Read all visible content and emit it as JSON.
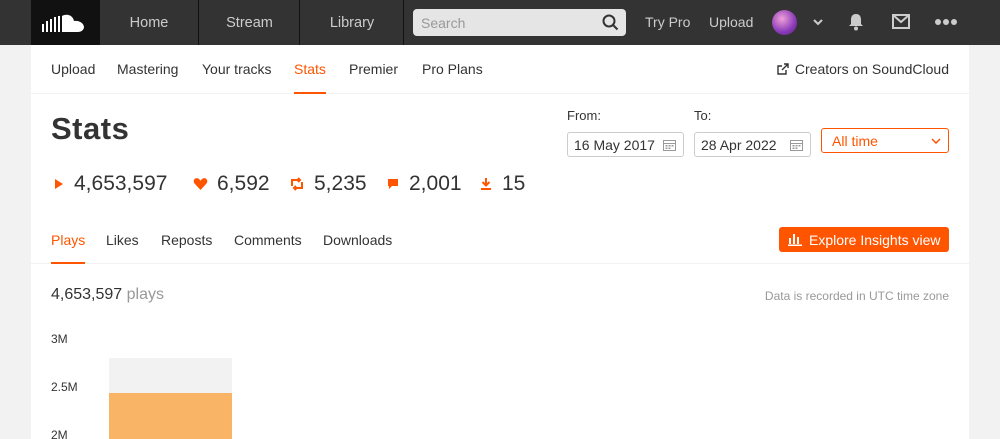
{
  "header": {
    "nav": [
      "Home",
      "Stream",
      "Library"
    ],
    "search_placeholder": "Search",
    "try_pro": "Try Pro",
    "upload": "Upload"
  },
  "subnav": {
    "items": [
      "Upload",
      "Mastering",
      "Your tracks",
      "Stats",
      "Premier",
      "Pro Plans"
    ],
    "active": "Stats",
    "creators": "Creators on SoundCloud"
  },
  "page": {
    "title": "Stats",
    "totals": {
      "plays": "4,653,597",
      "likes": "6,592",
      "reposts": "5,235",
      "comments": "2,001",
      "downloads": "15"
    },
    "from_label": "From:",
    "to_label": "To:",
    "from_date": "16 May 2017",
    "to_date": "28 Apr 2022",
    "range": "All time"
  },
  "tabs": {
    "items": [
      "Plays",
      "Likes",
      "Reposts",
      "Comments",
      "Downloads"
    ],
    "active": "Plays",
    "insights_button": "Explore Insights view"
  },
  "summary": {
    "plays_value": "4,653,597",
    "plays_unit": "plays",
    "utc_note": "Data is recorded in UTC time zone"
  },
  "colors": {
    "accent": "#ff5500",
    "bar": "#fab465",
    "header_bg": "#333333"
  },
  "chart_data": {
    "type": "bar",
    "categories": [
      ""
    ],
    "values": [
      2450000
    ],
    "y_ticks": [
      "3M",
      "2.5M",
      "2M"
    ],
    "y_tick_values": [
      3000000,
      2500000,
      2000000
    ],
    "xlabel": "",
    "ylabel": ""
  }
}
